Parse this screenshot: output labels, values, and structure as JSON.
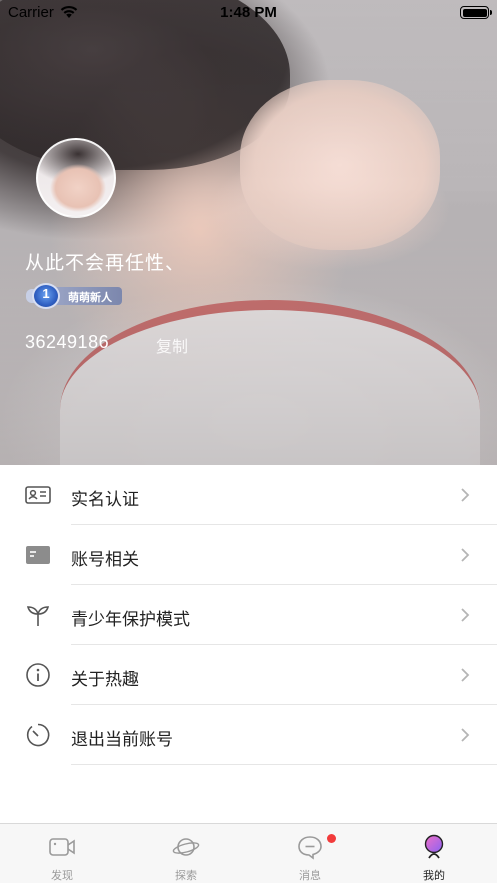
{
  "status_bar": {
    "carrier": "Carrier",
    "time": "1:48 PM",
    "icons": [
      "wifi-icon",
      "battery-icon"
    ]
  },
  "profile": {
    "nickname": "从此不会再任性、",
    "level": "1",
    "level_title": "萌萌新人",
    "user_id": "36249186",
    "copy_label": "复制"
  },
  "menu": {
    "items": [
      {
        "label": "实名认证",
        "icon": "id-card-icon"
      },
      {
        "label": "账号相关",
        "icon": "account-card-icon"
      },
      {
        "label": "青少年保护模式",
        "icon": "sprout-icon"
      },
      {
        "label": "关于热趣",
        "icon": "info-icon"
      },
      {
        "label": "退出当前账号",
        "icon": "logout-icon"
      }
    ],
    "chevron_icon": "chevron-right-icon"
  },
  "tab_bar": {
    "tabs": [
      {
        "label": "发现",
        "icon": "video-camera-icon",
        "active": false
      },
      {
        "label": "探索",
        "icon": "planet-icon",
        "active": false
      },
      {
        "label": "消息",
        "icon": "chat-bubble-icon",
        "active": false,
        "badge": "unread-dot"
      },
      {
        "label": "我的",
        "icon": "profile-icon",
        "active": true
      }
    ]
  },
  "colors": {
    "text_primary": "#222222",
    "tab_inactive": "#9a9a9a",
    "badge_red": "#f23b3b",
    "active_profile_purple": "#b36bf5"
  }
}
